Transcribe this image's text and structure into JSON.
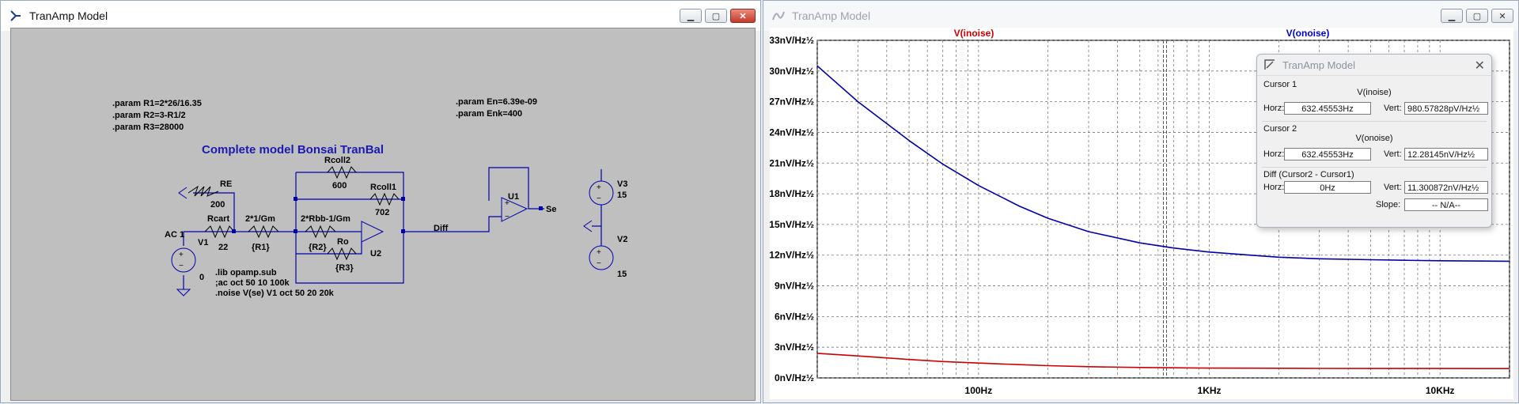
{
  "schematic_window": {
    "title": "TranAmp Model",
    "params_left": [
      ".param R1=2*26/16.35",
      ".param R2=3-R1/2",
      ".param R3=28000"
    ],
    "params_right": [
      ".param En=6.39e-09",
      ".param Enk=400"
    ],
    "heading": "Complete model Bonsai TranBal",
    "components": {
      "RE": "RE",
      "RE_val": "200",
      "Rcart": "Rcart",
      "Rcart_val": "22",
      "R1": "2*1/Gm",
      "R1_val": "{R1}",
      "R2": "2*Rbb-1/Gm",
      "R2_val": "{R2}",
      "Rcoll2": "Rcoll2",
      "Rcoll2_val": "600",
      "Rcoll1": "Rcoll1",
      "Rcoll1_val": "702",
      "Ro": "Ro",
      "Ro_val": "{R3}",
      "U2": "U2",
      "U1": "U1",
      "V1": "V1",
      "AC": "AC 1",
      "V1_val": "0",
      "V3": "V3",
      "V3_val": "15",
      "V2": "V2",
      "V2_val": "15",
      "net_diff": "Diff",
      "net_se": "Se"
    },
    "directives": [
      ".lib opamp.sub",
      ";ac oct 50 10 100k",
      ".noise V(se) V1 oct 50 20 20k"
    ]
  },
  "waveform_window": {
    "title": "TranAmp Model",
    "trace_labels": [
      "V(inoise)",
      "V(onoise)"
    ],
    "chart_data": {
      "type": "line",
      "x_scale": "log",
      "xlim": [
        20,
        20000
      ],
      "ylim": [
        0,
        33
      ],
      "y_ticks": [
        "0nV/Hz½",
        "3nV/Hz½",
        "6nV/Hz½",
        "9nV/Hz½",
        "12nV/Hz½",
        "15nV/Hz½",
        "18nV/Hz½",
        "21nV/Hz½",
        "24nV/Hz½",
        "27nV/Hz½",
        "30nV/Hz½",
        "33nV/Hz½"
      ],
      "x_ticks": [
        {
          "value": 100,
          "label": "100Hz"
        },
        {
          "value": 1000,
          "label": "1KHz"
        },
        {
          "value": 10000,
          "label": "10KHz"
        }
      ],
      "series": [
        {
          "name": "V(onoise)",
          "color": "#0000aa",
          "x": [
            20,
            30,
            50,
            70,
            100,
            150,
            200,
            300,
            500,
            700,
            1000,
            1500,
            2000,
            3000,
            5000,
            7000,
            10000,
            15000,
            20000
          ],
          "y": [
            30.5,
            27.0,
            23.2,
            20.9,
            18.8,
            16.8,
            15.6,
            14.3,
            13.2,
            12.7,
            12.3,
            12.0,
            11.8,
            11.65,
            11.55,
            11.5,
            11.45,
            11.42,
            11.4
          ]
        },
        {
          "name": "V(inoise)",
          "color": "#cc0000",
          "x": [
            20,
            30,
            50,
            70,
            100,
            150,
            200,
            300,
            500,
            700,
            1000,
            1500,
            2000,
            3000,
            5000,
            7000,
            10000,
            15000,
            20000
          ],
          "y": [
            2.4,
            2.15,
            1.8,
            1.6,
            1.45,
            1.3,
            1.2,
            1.1,
            1.02,
            0.99,
            0.96,
            0.95,
            0.94,
            0.93,
            0.92,
            0.92,
            0.92,
            0.91,
            0.91
          ]
        }
      ],
      "cursor_x": 632.45553,
      "grid": true
    },
    "cursor_dialog": {
      "title": "TranAmp Model",
      "cursor1_label": "Cursor 1",
      "cursor1_trace": "V(inoise)",
      "cursor1_horz": "632.45553Hz",
      "cursor1_vert": "980.57828pV/Hz½",
      "cursor2_label": "Cursor 2",
      "cursor2_trace": "V(onoise)",
      "cursor2_horz": "632.45553Hz",
      "cursor2_vert": "12.28145nV/Hz½",
      "diff_label": "Diff (Cursor2 - Cursor1)",
      "diff_horz": "0Hz",
      "diff_vert": "11.300872nV/Hz½",
      "slope_value": "-- N/A--",
      "horz_label": "Horz:",
      "vert_label": "Vert:",
      "slope_label": "Slope:"
    }
  }
}
